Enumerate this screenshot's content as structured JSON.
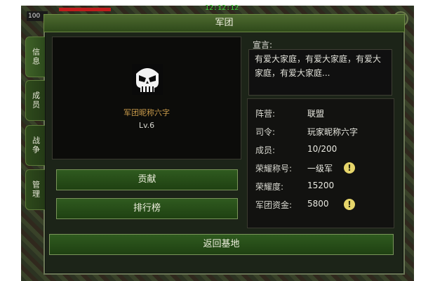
{
  "hud": {
    "left_value": "100",
    "time": "12:12:12"
  },
  "window": {
    "title": "军团"
  },
  "tabs": [
    {
      "label": "信息",
      "active": true
    },
    {
      "label": "成员",
      "active": false
    },
    {
      "label": "战争",
      "active": false
    },
    {
      "label": "管理",
      "active": false
    }
  ],
  "guild": {
    "name": "军团昵称六字",
    "level": "Lv.6",
    "emblem_icon": "skull-emblem-icon"
  },
  "buttons": {
    "contribute": "贡献",
    "ranking": "排行榜",
    "return_base": "返回基地"
  },
  "declaration": {
    "label": "宣言:",
    "text": "有爱大家庭，有爱大家庭，有爱大家庭，有爱大家庭..."
  },
  "info": {
    "camp_label": "阵营:",
    "camp_value": "联盟",
    "commander_label": "司令:",
    "commander_value": "玩家昵称六字",
    "members_label": "成员:",
    "members_value": "10/200",
    "honor_title_label": "荣耀称号:",
    "honor_title_value": "一级军",
    "honor_label": "荣耀度:",
    "honor_value": "15200",
    "funds_label": "军团资金:",
    "funds_value": "5800"
  },
  "warning_glyph": "!",
  "colors": {
    "accent_green": "#2f5a1f",
    "guild_name": "#c89a4a",
    "warn": "#e6d56a"
  }
}
